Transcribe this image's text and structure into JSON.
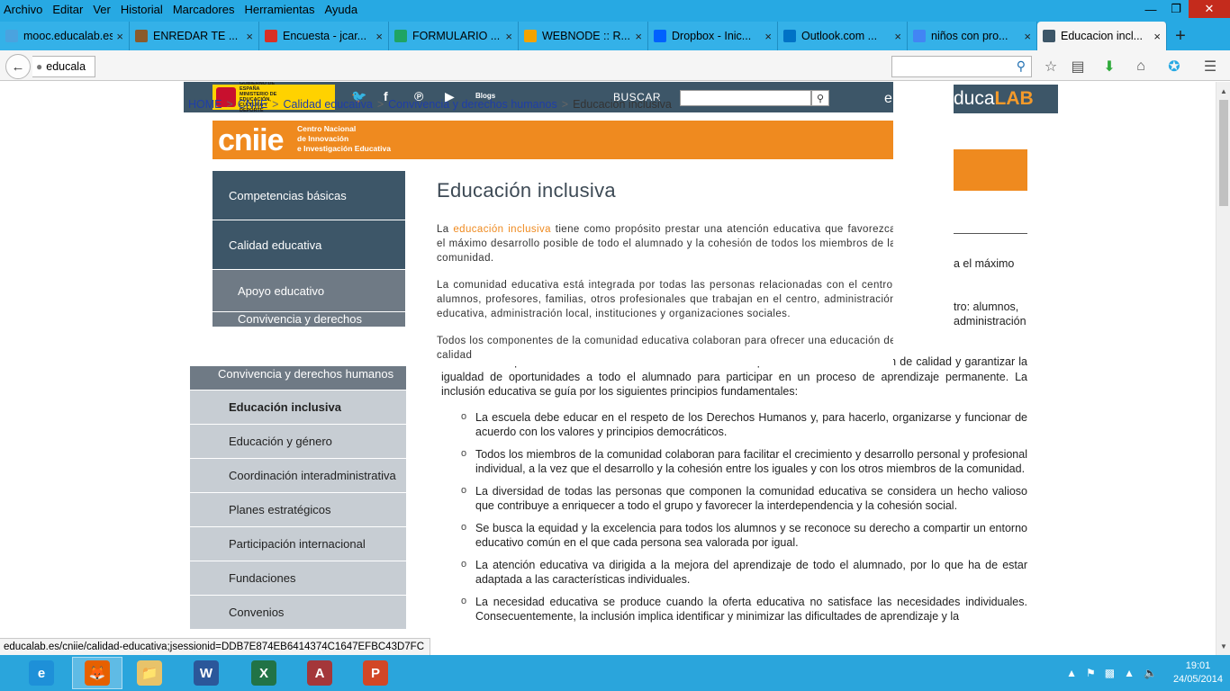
{
  "menu": [
    "Archivo",
    "Editar",
    "Ver",
    "Historial",
    "Marcadores",
    "Herramientas",
    "Ayuda"
  ],
  "tabs": [
    {
      "label": "mooc.educalab.es",
      "icon": "globe-icon",
      "color": "#4aa3df"
    },
    {
      "label": "ENREDAR TE ...",
      "icon": "image-icon",
      "color": "#8a5a2b"
    },
    {
      "label": "Encuesta - jcar...",
      "icon": "gmail-icon",
      "color": "#d93025"
    },
    {
      "label": "FORMULARIO ...",
      "icon": "google-drive-icon",
      "color": "#1fa463"
    },
    {
      "label": "WEBNODE :: R...",
      "icon": "webnode-icon",
      "color": "#f4a300"
    },
    {
      "label": "Dropbox - Inic...",
      "icon": "dropbox-icon",
      "color": "#0061fe"
    },
    {
      "label": "Outlook.com ...",
      "icon": "outlook-icon",
      "color": "#0072c6"
    },
    {
      "label": "niños con pro...",
      "icon": "google-icon",
      "color": "#4285f4"
    },
    {
      "label": "Educacion incl...",
      "icon": "educalab-icon",
      "color": "#3d5668"
    }
  ],
  "url_text": "educala",
  "page": {
    "gov": {
      "logo_text": "GOBIERNO DE ESPAÑA   MINISTERIO DE EDUCACIÓN, CULTURA Y DEPORTE",
      "blogs": "Blogs",
      "buscar": "BUSCAR",
      "e_letter": "e"
    },
    "breadcrumb": [
      {
        "label": "HOME",
        "link": true
      },
      {
        "label": "CNIIE",
        "link": true
      },
      {
        "label": "Calidad educativa",
        "link": true
      },
      {
        "label": "Convivencia y derechos humanos",
        "link": true
      },
      {
        "label": "Educación inclusiva",
        "link": false
      }
    ],
    "cniie": {
      "logo": "cniie",
      "line1": "Centro Nacional",
      "line2": "de Innovación",
      "line3": "e Investigación Educativa"
    },
    "overlay_sidebar": [
      "Competencias básicas",
      "Calidad educativa",
      "Apoyo educativo",
      "Convivencia y derechos humanos"
    ],
    "title": "Educación inclusiva",
    "overlay_paragraphs": {
      "p1_pre": "La",
      "p1_link": "educación inclusiva",
      "p1_post": "tiene como propósito prestar una atención educativa que favorezca el máximo desarrollo posible de todo el alumnado y la cohesión de todos los miembros de la comunidad.",
      "p2": "La comunidad educativa está integrada por todas las personas relacionadas con el centro: alumnos, profesores, familias, otros profesionales que trabajan en el centro, administración educativa, administración local, instituciones y organizaciones sociales.",
      "p3": "Todos los componentes de la comunidad educativa colaboran para ofrecer una educación de calidad"
    },
    "background": {
      "brand_prefix": "duca",
      "brand_suffix": "LAB",
      "snip1": "a el máximo",
      "snip2": "tro: alumnos,",
      "snip3": "administración",
      "sidebar": [
        {
          "label": "Convivencia y derechos humanos",
          "kind": "head"
        },
        {
          "label": "Educación inclusiva",
          "kind": "active"
        },
        {
          "label": "Educación y género",
          "kind": "sub"
        },
        {
          "label": "Coordinación interadministrativa",
          "kind": "tall"
        },
        {
          "label": "Planes estratégicos",
          "kind": "sub"
        },
        {
          "label": "Participación internacional",
          "kind": "sub"
        },
        {
          "label": "Fundaciones",
          "kind": "sub"
        },
        {
          "label": "Convenios",
          "kind": "sub"
        }
      ],
      "intro": "Todos los componentes de la comunidad educativa colaboran para ofrecer una educación de calidad y garantizar la igualdad de oportunidades a todo el alumnado para participar en un proceso de aprendizaje permanente. La inclusión educativa se guía por los siguientes principios fundamentales:",
      "principles": [
        "La escuela debe educar en el respeto de los Derechos Humanos y, para hacerlo, organizarse y funcionar de acuerdo con los valores y principios democráticos.",
        "Todos los miembros de la comunidad colaboran para facilitar el crecimiento y desarrollo personal y profesional individual, a la vez que el desarrollo y la cohesión entre los iguales y con los otros miembros de la comunidad.",
        "La diversidad de todas las personas que componen la comunidad educativa se considera un hecho valioso que contribuye a enriquecer a todo el grupo y favorecer la interdependencia y la cohesión social.",
        "Se busca la equidad y la excelencia para todos los alumnos y se reconoce su derecho a compartir un entorno educativo común en el que cada persona sea valorada por igual.",
        "La atención educativa va dirigida a la mejora del aprendizaje de todo el alumnado, por lo que ha de estar adaptada a las características individuales.",
        "La necesidad educativa se produce cuando la oferta educativa no satisface las necesidades individuales. Consecuentemente, la inclusión implica identificar y minimizar las dificultades de aprendizaje y la"
      ]
    }
  },
  "status_url": "educalab.es/cniie/calidad-educativa;jsessionid=DDB7E874EB6414374C1647EFBC43D7FC",
  "taskbar": {
    "apps": [
      {
        "name": "internet-explorer-icon",
        "letter": "e",
        "color": "#1e90d8"
      },
      {
        "name": "firefox-icon",
        "letter": "🦊",
        "color": "#e66000"
      },
      {
        "name": "file-explorer-icon",
        "letter": "📁",
        "color": "#e8c36a"
      },
      {
        "name": "word-icon",
        "letter": "W",
        "color": "#2b579a"
      },
      {
        "name": "excel-icon",
        "letter": "X",
        "color": "#217346"
      },
      {
        "name": "access-icon",
        "letter": "A",
        "color": "#a4373a"
      },
      {
        "name": "powerpoint-icon",
        "letter": "P",
        "color": "#d24726"
      }
    ],
    "time": "19:01",
    "date": "24/05/2014"
  }
}
